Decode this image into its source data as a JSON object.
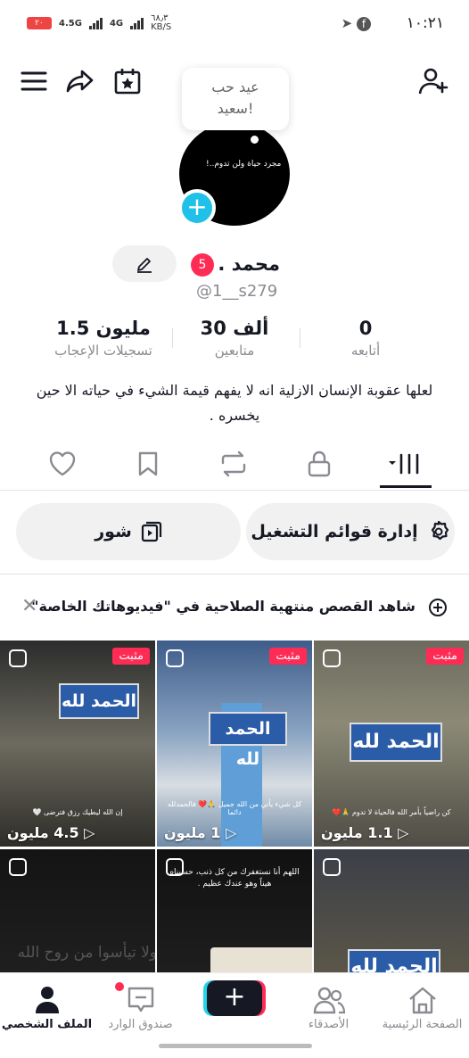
{
  "status_bar": {
    "time": "١٠:٢١",
    "battery": "٢٠",
    "network_1": "4.5G",
    "network_2": "4G",
    "speed": "٦٨٫٣",
    "speed_unit": "KB/S"
  },
  "bubble": {
    "line1": "عيد حب",
    "line2": "سعيد!"
  },
  "avatar_text": "مجرد حياة ولن تدوم..!",
  "profile": {
    "name": "محمد .",
    "badge": "5",
    "handle": "@1__s279"
  },
  "stats": [
    {
      "value": "0",
      "label": "أتابعه"
    },
    {
      "value": "30 ألف",
      "label": "متابعين"
    },
    {
      "value": "1.5 مليون",
      "label": "تسجيلات الإعجاب"
    }
  ],
  "bio": "لعلها عقوبة الإنسان الازلية انه لا يفهم قيمة الشيء في حياته الا حين يخسره .",
  "tabs": [
    "videos-icon",
    "lock-icon",
    "repost-icon",
    "bookmark-icon",
    "heart-icon"
  ],
  "pills": {
    "playlists": "إدارة قوائم التشغيل",
    "shorts": "شور"
  },
  "notice": "شاهد القصص منتهية الصلاحية في \"فيديوهاتك الخاصة\"",
  "videos": [
    {
      "pinned": "مثبت",
      "views": "1.1 مليون",
      "caption": "كن راضياً بأمر الله فالحياة لا تدوم 🙏❤️",
      "sign": "الحمد لله"
    },
    {
      "pinned": "مثبت",
      "views": "1 مليون",
      "caption": "كل شيء يأتي من الله جميل 🙏❤️ فالحمدلله دائما",
      "sign": "الحمد لله"
    },
    {
      "pinned": "مثبت",
      "views": "4.5 مليون",
      "caption": "إن الله ليطيك رزق فترضى 🤍",
      "sign": "الحمد لله"
    },
    {
      "pinned": "",
      "views": "",
      "caption": "",
      "sign": "الحمد لله"
    },
    {
      "pinned": "",
      "views": "",
      "caption": "اللهم أنا نستغفرك من كل ذنب، حسبناه هيناً وهو عندك عظيم .",
      "sign": ""
    },
    {
      "pinned": "",
      "views": "",
      "caption": "",
      "sign": "ولا تيأسوا من روح الله"
    }
  ],
  "bottom_nav": {
    "home": "الصفحة الرئيسية",
    "friends": "الأصدقاء",
    "inbox": "صندوق الوارد",
    "profile": "الملف الشخصي"
  },
  "colors": {
    "accent": "#fe2c55",
    "cyan": "#20c0e8",
    "text": "#161823",
    "muted": "#8a8b91"
  }
}
